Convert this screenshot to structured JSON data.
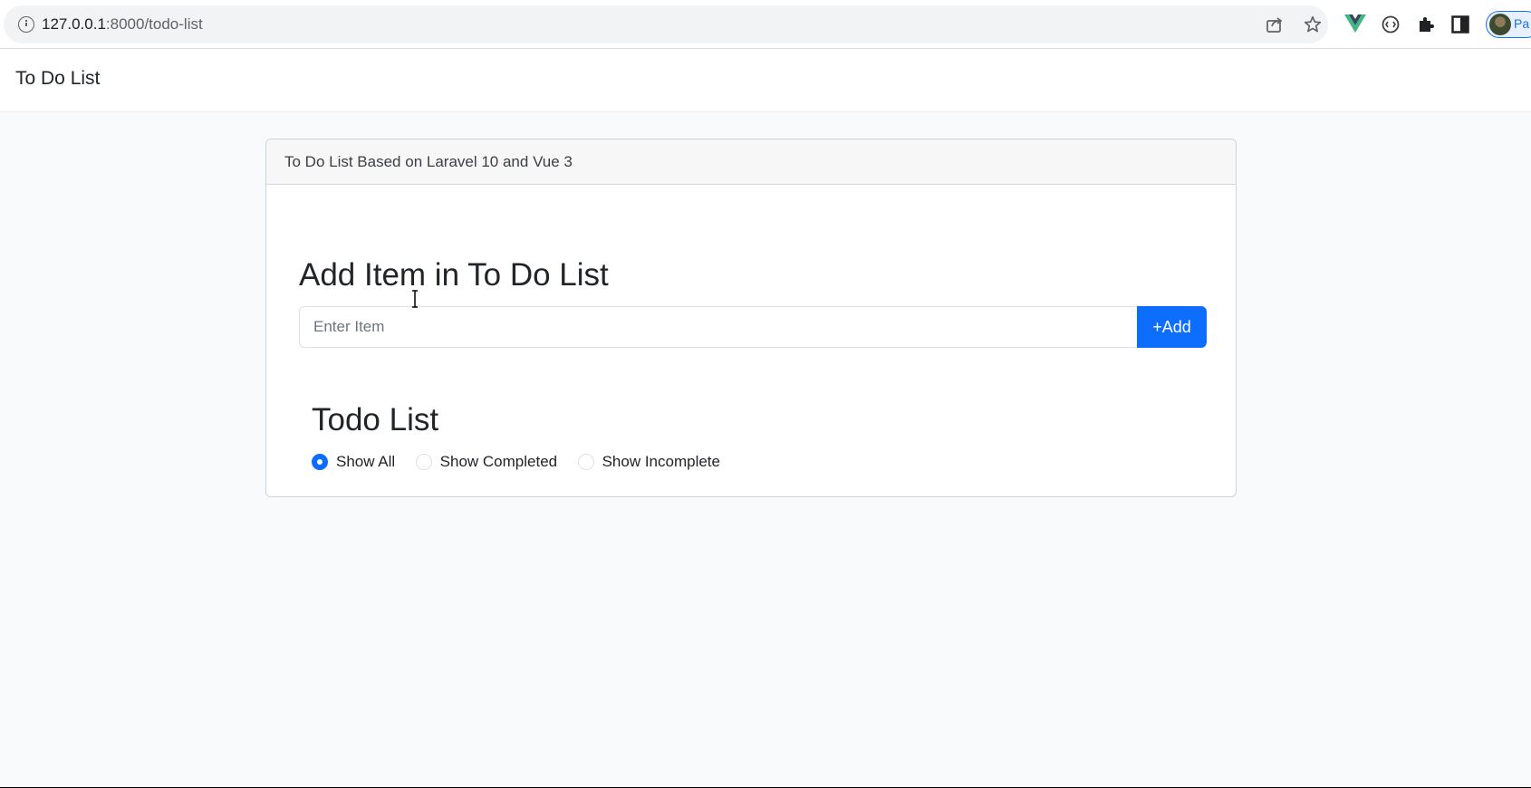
{
  "browser": {
    "url_host": "127.0.0.1",
    "url_rest": ":8000/todo-list",
    "profile_label": "Pa"
  },
  "navbar": {
    "brand": "To Do List"
  },
  "card": {
    "header": "To Do List Based on Laravel 10 and Vue 3",
    "add_heading": "Add Item in To Do List",
    "input_placeholder": "Enter Item",
    "input_value": "",
    "add_button": "+Add",
    "list_heading": "Todo List",
    "filters": [
      {
        "label": "Show All",
        "checked": true
      },
      {
        "label": "Show Completed",
        "checked": false
      },
      {
        "label": "Show Incomplete",
        "checked": false
      }
    ]
  },
  "colors": {
    "primary": "#0d6efd",
    "page_background": "#f8fafc",
    "card_header_bg": "#f7f7f7"
  },
  "icons": [
    "info-icon",
    "share-icon",
    "star-icon",
    "vue-devtools-icon",
    "extension-icon",
    "puzzle-icon",
    "side-panel-icon",
    "avatar"
  ]
}
